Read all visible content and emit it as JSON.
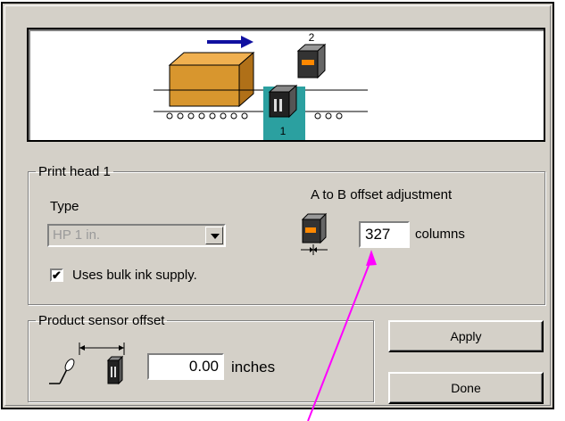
{
  "diagram": {
    "head_labels": [
      "2",
      "1"
    ],
    "direction_icon": "right-arrow-icon",
    "highlight_color": "#2ba0a0"
  },
  "print_head": {
    "legend": "Print head 1",
    "type_label": "Type",
    "type_value": "HP 1 in.",
    "bulk_ink_checked": true,
    "bulk_ink_label": "Uses bulk ink supply.",
    "offset_title": "A to B offset adjustment",
    "offset_value": "327",
    "offset_unit": "columns"
  },
  "sensor": {
    "legend": "Product sensor offset",
    "value": "0.00",
    "unit": "inches"
  },
  "buttons": {
    "apply": "Apply",
    "done": "Done"
  },
  "pointer_color": "#ff00ff"
}
